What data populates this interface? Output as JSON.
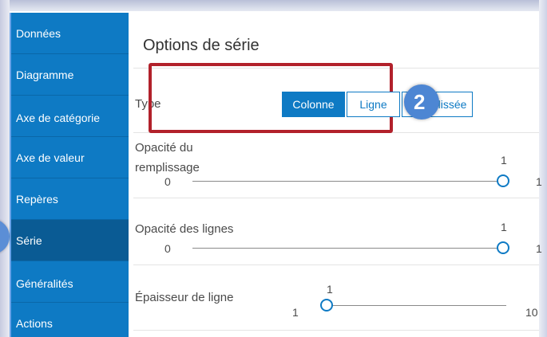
{
  "sidebar": {
    "items": [
      {
        "label": "Données"
      },
      {
        "label": "Diagramme"
      },
      {
        "label": "Axe de catégorie"
      },
      {
        "label": "Axe de valeur"
      },
      {
        "label": "Repères"
      },
      {
        "label": "Série"
      },
      {
        "label": "Généralités"
      },
      {
        "label": "Actions"
      }
    ],
    "active_item": "Série"
  },
  "panel": {
    "title": "Options de série",
    "type_row": {
      "label": "Type",
      "options": [
        "Colonne",
        "Ligne",
        "Ligne lissée"
      ],
      "selected": "Colonne"
    },
    "fill_opacity": {
      "label_line1": "Opacité du",
      "label_line2": "remplissage",
      "min": "0",
      "max": "1",
      "value": "1"
    },
    "line_opacity": {
      "label": "Opacité des lignes",
      "min": "0",
      "max": "1",
      "value": "1"
    },
    "line_width": {
      "label": "Épaisseur de ligne",
      "min": "1",
      "max": "10",
      "value": "1"
    }
  },
  "callout_badge": "2",
  "colors": {
    "sidebar_bg": "#0e7ac4",
    "sidebar_active": "#0a5b94",
    "accent": "#0e7ac4",
    "highlight_border": "#b2212b",
    "badge": "#4d86d3"
  }
}
